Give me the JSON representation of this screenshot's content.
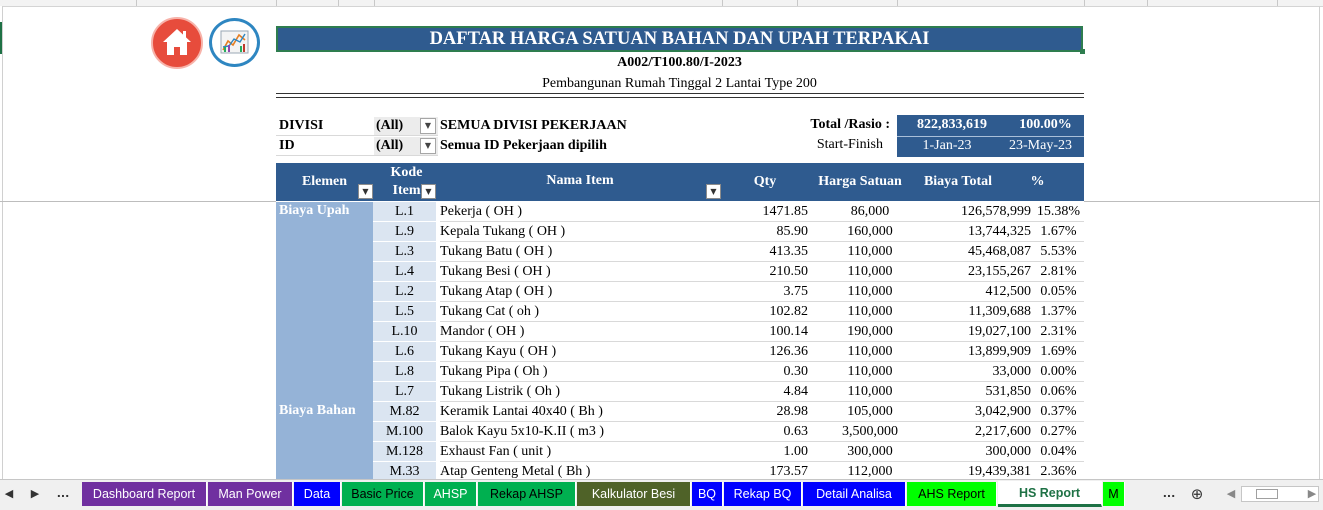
{
  "title": "DAFTAR HARGA SATUAN BAHAN DAN UPAH TERPAKAI",
  "doc_code": "A002/T100.80/I-2023",
  "project": "Pembangunan Rumah Tinggal 2 Lantai Type 200",
  "icons": {
    "home": "home-icon",
    "chart": "dashboard-chart-icon",
    "dropdown": "dropdown-arrow-icon"
  },
  "colors": {
    "header_blue": "#2f5b8f",
    "group_blue": "#95b3d7",
    "code_blue": "#dbe5f1",
    "home_red": "#e74c3c"
  },
  "filters": {
    "divisi": {
      "label": "DIVISI",
      "value": "(All)",
      "desc": "SEMUA DIVISI PEKERJAAN"
    },
    "id": {
      "label": "ID",
      "value": "(All)",
      "desc": "Semua ID Pekerjaan dipilih"
    }
  },
  "summary": {
    "total_label": "Total /Rasio :",
    "total": "822,833,619",
    "ratio": "100.00%",
    "sf_label": "Start-Finish",
    "start": "1-Jan-23",
    "finish": "23-May-23"
  },
  "columns": {
    "elemen": "Elemen",
    "kode_1": "Kode",
    "kode_2": "Item",
    "nama": "Nama Item",
    "qty": "Qty",
    "harga": "Harga Satuan",
    "biaya": "Biaya Total",
    "pct": "%"
  },
  "groups": [
    {
      "name": "Biaya Upah",
      "rows": 10
    },
    {
      "name": "Biaya Bahan",
      "rows": 4
    }
  ],
  "rows": [
    {
      "kode": "L.1",
      "nama": "Pekerja ( OH )",
      "qty": "1471.85",
      "harga": "86,000",
      "biaya": "126,578,999",
      "pct": "15.38%"
    },
    {
      "kode": "L.9",
      "nama": "Kepala Tukang ( OH )",
      "qty": "85.90",
      "harga": "160,000",
      "biaya": "13,744,325",
      "pct": "1.67%"
    },
    {
      "kode": "L.3",
      "nama": "Tukang Batu ( OH )",
      "qty": "413.35",
      "harga": "110,000",
      "biaya": "45,468,087",
      "pct": "5.53%"
    },
    {
      "kode": "L.4",
      "nama": "Tukang Besi ( OH )",
      "qty": "210.50",
      "harga": "110,000",
      "biaya": "23,155,267",
      "pct": "2.81%"
    },
    {
      "kode": "L.2",
      "nama": "Tukang Atap ( OH )",
      "qty": "3.75",
      "harga": "110,000",
      "biaya": "412,500",
      "pct": "0.05%"
    },
    {
      "kode": "L.5",
      "nama": "Tukang Cat ( oh )",
      "qty": "102.82",
      "harga": "110,000",
      "biaya": "11,309,688",
      "pct": "1.37%"
    },
    {
      "kode": "L.10",
      "nama": "Mandor ( OH )",
      "qty": "100.14",
      "harga": "190,000",
      "biaya": "19,027,100",
      "pct": "2.31%"
    },
    {
      "kode": "L.6",
      "nama": "Tukang Kayu ( OH )",
      "qty": "126.36",
      "harga": "110,000",
      "biaya": "13,899,909",
      "pct": "1.69%"
    },
    {
      "kode": "L.8",
      "nama": "Tukang Pipa ( Oh )",
      "qty": "0.30",
      "harga": "110,000",
      "biaya": "33,000",
      "pct": "0.00%"
    },
    {
      "kode": "L.7",
      "nama": "Tukang Listrik ( Oh )",
      "qty": "4.84",
      "harga": "110,000",
      "biaya": "531,850",
      "pct": "0.06%"
    },
    {
      "kode": "M.82",
      "nama": "Keramik Lantai 40x40 ( Bh )",
      "qty": "28.98",
      "harga": "105,000",
      "biaya": "3,042,900",
      "pct": "0.37%"
    },
    {
      "kode": "M.100",
      "nama": "Balok Kayu 5x10-K.II ( m3 )",
      "qty": "0.63",
      "harga": "3,500,000",
      "biaya": "2,217,600",
      "pct": "0.27%"
    },
    {
      "kode": "M.128",
      "nama": "Exhaust Fan ( unit )",
      "qty": "1.00",
      "harga": "300,000",
      "biaya": "300,000",
      "pct": "0.04%"
    },
    {
      "kode": "M.33",
      "nama": "Atap Genteng Metal ( Bh )",
      "qty": "173.57",
      "harga": "112,000",
      "biaya": "19,439,381",
      "pct": "2.36%"
    }
  ],
  "tabbar": {
    "prev": "◀",
    "next": "▶",
    "more_left": "...",
    "more_right": "...",
    "add": "⊕",
    "scroll_left": "◀",
    "scroll_right": "▶",
    "tabs": [
      {
        "label": "Dashboard Report",
        "bg": "#7030a0",
        "fg": "#ffffff"
      },
      {
        "label": "Man Power",
        "bg": "#7030a0",
        "fg": "#ffffff"
      },
      {
        "label": "Data",
        "bg": "#0000ff",
        "fg": "#ffffff"
      },
      {
        "label": "Basic Price",
        "bg": "#00b050",
        "fg": "#000000"
      },
      {
        "label": "AHSP",
        "bg": "#00b050",
        "fg": "#ffffff"
      },
      {
        "label": "Rekap AHSP",
        "bg": "#00b050",
        "fg": "#000000"
      },
      {
        "label": "Kalkulator Besi",
        "bg": "#4f6228",
        "fg": "#ffffff"
      },
      {
        "label": "BQ",
        "bg": "#0000ff",
        "fg": "#ffffff"
      },
      {
        "label": "Rekap BQ",
        "bg": "#0000ff",
        "fg": "#ffffff"
      },
      {
        "label": "Detail Analisa",
        "bg": "#0000ff",
        "fg": "#ffffff"
      },
      {
        "label": "AHS Report",
        "bg": "#00ff00",
        "fg": "#000000"
      },
      {
        "label": "HS Report",
        "bg": "#ffffff",
        "fg": "#1e7145"
      },
      {
        "label": "M",
        "bg": "#00ff00",
        "fg": "#000000"
      }
    ]
  }
}
